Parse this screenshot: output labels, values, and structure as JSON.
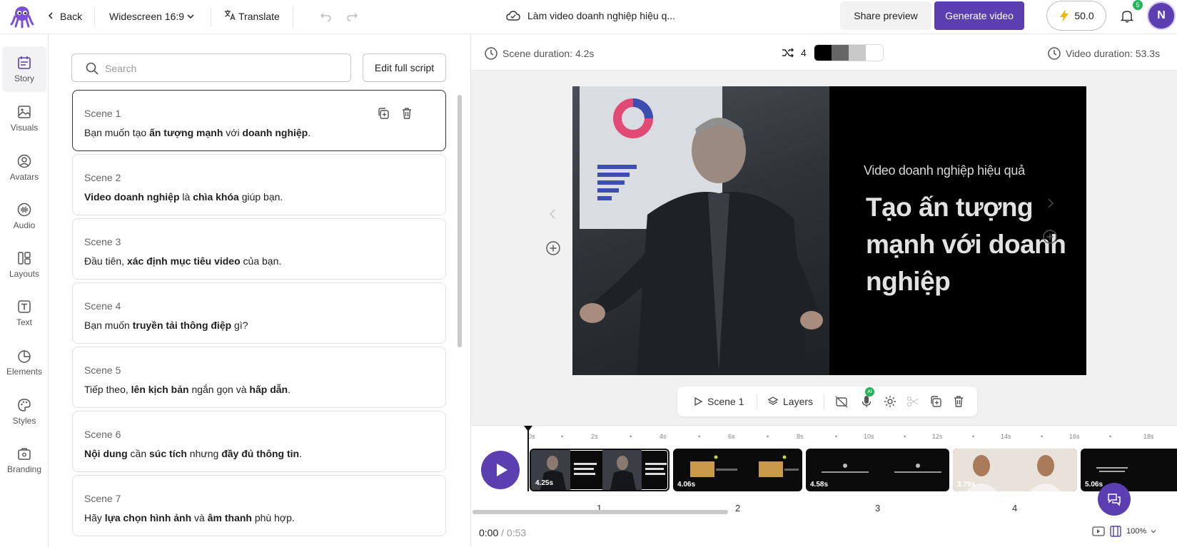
{
  "topbar": {
    "back_label": "Back",
    "aspect_label": "Widescreen 16:9",
    "translate_label": "Translate",
    "doc_title": "Làm video doanh nghiệp hiệu q...",
    "share_label": "Share preview",
    "generate_label": "Generate video",
    "credits": "50.0",
    "notifications": "5",
    "avatar_initial": "N",
    "accent_color": "#5b3fb1"
  },
  "sidebar": {
    "items": [
      {
        "label": "Story",
        "icon": "story-icon"
      },
      {
        "label": "Visuals",
        "icon": "image-icon"
      },
      {
        "label": "Avatars",
        "icon": "avatar-icon"
      },
      {
        "label": "Audio",
        "icon": "audio-wave-icon"
      },
      {
        "label": "Layouts",
        "icon": "layout-icon"
      },
      {
        "label": "Text",
        "icon": "text-icon"
      },
      {
        "label": "Elements",
        "icon": "elements-icon"
      },
      {
        "label": "Styles",
        "icon": "palette-icon"
      },
      {
        "label": "Branding",
        "icon": "briefcase-icon"
      }
    ]
  },
  "story": {
    "search_placeholder": "Search",
    "edit_script_label": "Edit full script",
    "scenes": [
      {
        "title": "Scene 1",
        "parts": [
          "Bạn muốn tạo ",
          "ấn tượng mạnh",
          " với ",
          "doanh nghiệp",
          "."
        ]
      },
      {
        "title": "Scene 2",
        "parts": [
          "",
          "Video doanh nghiệp",
          " là ",
          "chìa khóa",
          " giúp bạn."
        ]
      },
      {
        "title": "Scene 3",
        "parts": [
          "Đầu tiên, ",
          "xác định mục tiêu video",
          " của bạn.",
          "",
          ""
        ]
      },
      {
        "title": "Scene 4",
        "parts": [
          "Bạn muốn ",
          "truyền tải thông điệp",
          " gì?",
          "",
          ""
        ]
      },
      {
        "title": "Scene 5",
        "parts": [
          "Tiếp theo, ",
          "lên kịch bản",
          " ngắn gọn và ",
          "hấp dẫn",
          "."
        ]
      },
      {
        "title": "Scene 6",
        "parts": [
          "",
          "Nội dung",
          " cần ",
          "súc tích",
          " nhưng ",
          "đầy đủ thông tin",
          "."
        ]
      },
      {
        "title": "Scene 7",
        "parts": [
          "Hãy ",
          "lựa chọn hình ảnh",
          " và ",
          "âm thanh",
          " phù hợp."
        ]
      }
    ]
  },
  "editor": {
    "scene_duration": "Scene duration: 4.2s",
    "shuffle_count": "4",
    "palette": [
      "#000000",
      "#666666",
      "#c8c8c8",
      "#ffffff"
    ],
    "video_duration": "Video duration: 53.3s",
    "preview": {
      "subtitle": "Video doanh nghiệp hiệu quả",
      "title": "Tạo ấn tượng mạnh với doanh nghiệp"
    },
    "toolbar": {
      "scene_label": "Scene 1",
      "layers_label": "Layers",
      "ai_badge": "AI"
    }
  },
  "timeline": {
    "ticks": [
      "0s",
      "•",
      "2s",
      "•",
      "4s",
      "•",
      "6s",
      "•",
      "8s",
      "•",
      "10s",
      "•",
      "12s",
      "•",
      "14s",
      "•",
      "16s",
      "•",
      "18s"
    ],
    "clips": [
      {
        "duration": "4.25s",
        "number": "1"
      },
      {
        "duration": "4.06s",
        "number": "2"
      },
      {
        "duration": "4.58s",
        "number": "3"
      },
      {
        "duration": "3.79s",
        "number": "4"
      },
      {
        "duration": "5.06s",
        "number": ""
      }
    ],
    "current_time": "0:00",
    "total_time": "/ 0:53",
    "zoom": "100%"
  }
}
